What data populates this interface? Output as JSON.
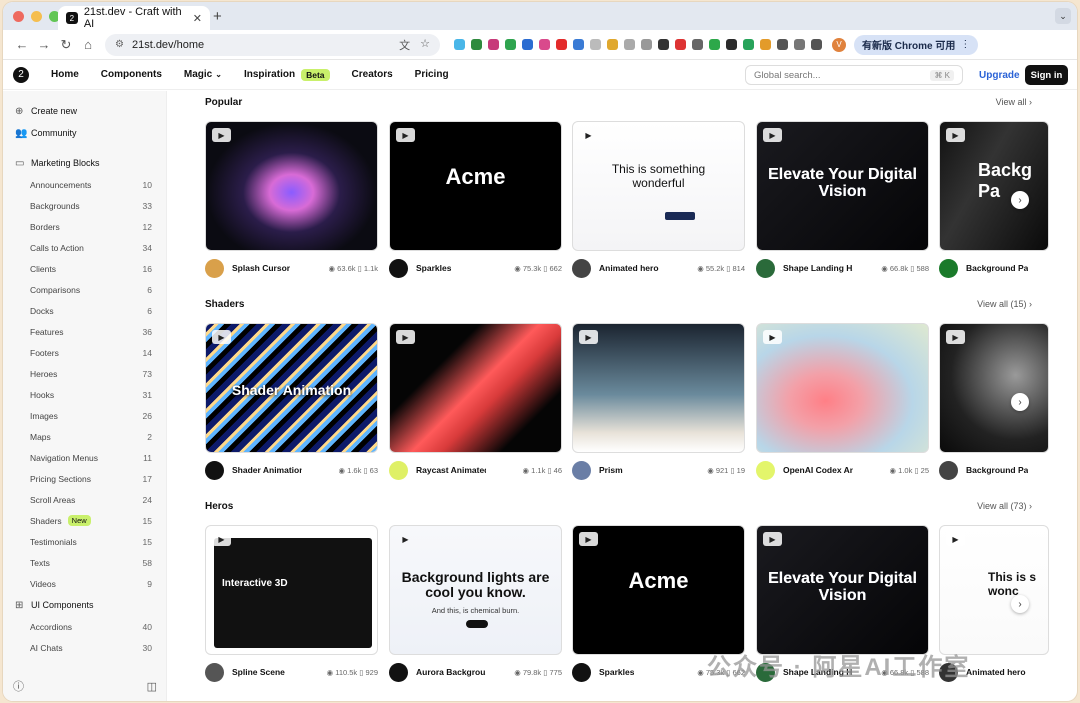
{
  "browser": {
    "tab_title": "21st.dev - Craft with AI",
    "url": "21st.dev/home",
    "update_label": "有新版 Chrome 可用",
    "avatar_letter": "V"
  },
  "site": {
    "logo": "2",
    "nav": [
      "Home",
      "Components",
      "Magic",
      "Inspiration",
      "Creators",
      "Pricing"
    ],
    "beta": "Beta",
    "search_placeholder": "Global search...",
    "search_kbd": "⌘ K",
    "upgrade": "Upgrade",
    "signin": "Sign in"
  },
  "sidebar": {
    "create_new": "Create new",
    "community": "Community",
    "marketing": "Marketing Blocks",
    "ui_components": "UI Components",
    "new_badge": "New",
    "items": [
      [
        "Announcements",
        "10"
      ],
      [
        "Backgrounds",
        "33"
      ],
      [
        "Borders",
        "12"
      ],
      [
        "Calls to Action",
        "34"
      ],
      [
        "Clients",
        "16"
      ],
      [
        "Comparisons",
        "6"
      ],
      [
        "Docks",
        "6"
      ],
      [
        "Features",
        "36"
      ],
      [
        "Footers",
        "14"
      ],
      [
        "Heroes",
        "73"
      ],
      [
        "Hooks",
        "31"
      ],
      [
        "Images",
        "26"
      ],
      [
        "Maps",
        "2"
      ],
      [
        "Navigation Menus",
        "11"
      ],
      [
        "Pricing Sections",
        "17"
      ],
      [
        "Scroll Areas",
        "24"
      ],
      [
        "Shaders",
        "15"
      ],
      [
        "Testimonials",
        "15"
      ],
      [
        "Texts",
        "58"
      ],
      [
        "Videos",
        "9"
      ]
    ],
    "ui_items": [
      [
        "Accordions",
        "40"
      ],
      [
        "AI Chats",
        "30"
      ]
    ]
  },
  "sections": [
    {
      "title": "Popular",
      "view_all": "View all",
      "cards": [
        {
          "name": "Splash Cursor",
          "views": "63.6k",
          "saves": "1.1k",
          "text": ""
        },
        {
          "name": "Sparkles",
          "views": "75.3k",
          "saves": "662",
          "text": "Acme"
        },
        {
          "name": "Animated hero",
          "views": "55.2k",
          "saves": "814",
          "text": "This is something wonderful"
        },
        {
          "name": "Shape Landing H...",
          "views": "66.8k",
          "saves": "588",
          "text": "Elevate Your Digital Vision"
        },
        {
          "name": "Background Pa",
          "views": "",
          "saves": "",
          "text": "Backg Pa"
        }
      ]
    },
    {
      "title": "Shaders",
      "view_all": "View all (15)",
      "cards": [
        {
          "name": "Shader Animation",
          "views": "1.6k",
          "saves": "63",
          "text": "Shader Animation"
        },
        {
          "name": "Raycast Animated ...",
          "views": "1.1k",
          "saves": "46",
          "text": ""
        },
        {
          "name": "Prism",
          "views": "921",
          "saves": "19",
          "text": ""
        },
        {
          "name": "OpenAI Codex Ani...",
          "views": "1.0k",
          "saves": "25",
          "text": ""
        },
        {
          "name": "Background Pa",
          "views": "",
          "saves": "",
          "text": ""
        }
      ]
    },
    {
      "title": "Heros",
      "view_all": "View all (73)",
      "cards": [
        {
          "name": "Spline Scene",
          "views": "110.5k",
          "saves": "929",
          "text": "Interactive 3D"
        },
        {
          "name": "Aurora Backgrou...",
          "views": "79.8k",
          "saves": "775",
          "text": "Background lights are cool you know."
        },
        {
          "name": "Sparkles",
          "views": "75.3k",
          "saves": "662",
          "text": "Acme"
        },
        {
          "name": "Shape Landing H...",
          "views": "66.8k",
          "saves": "588",
          "text": "Elevate Your Digital Vision"
        },
        {
          "name": "Animated hero",
          "views": "",
          "saves": "",
          "text": "This is s wonc"
        }
      ]
    }
  ],
  "hero_sub": {
    "aurora": "And this, is chemical burn.",
    "wonderful_btn": "Sign up now"
  },
  "watermark": "公众号 · 阿星AI工作室"
}
